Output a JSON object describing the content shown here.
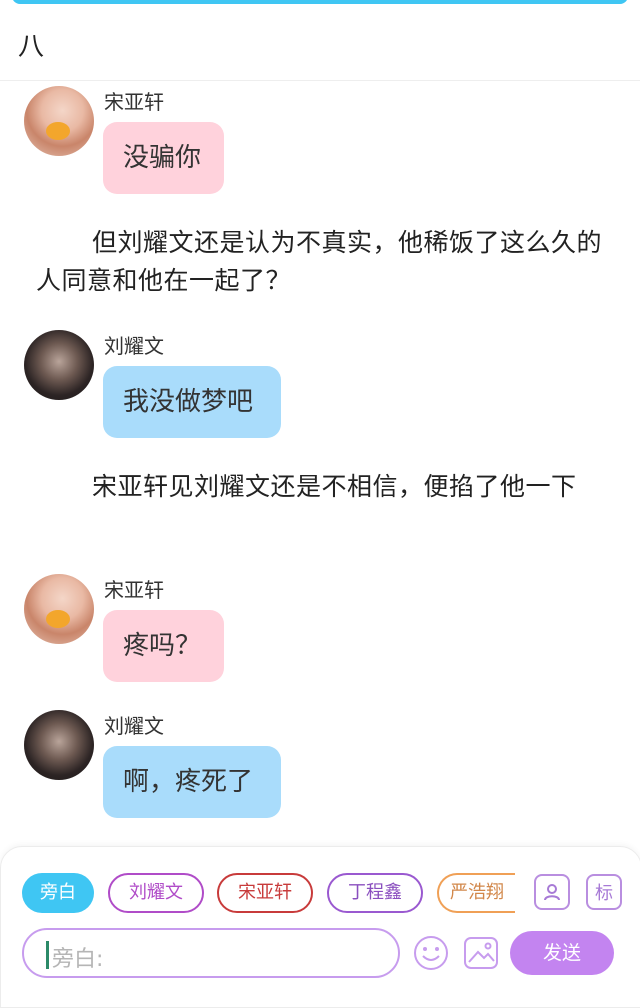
{
  "header": {
    "title": "八"
  },
  "messages": [
    {
      "speaker": "宋亚轩",
      "text": "没骗你"
    },
    {
      "narration": "但刘耀文还是认为不真实，他稀饭了这么久的人同意和他在一起了？"
    },
    {
      "speaker": "刘耀文",
      "text": "我没做梦吧"
    },
    {
      "narration": "宋亚轩见刘耀文还是不相信，便掐了他一下"
    },
    {
      "speaker": "宋亚轩",
      "text": "疼吗？"
    },
    {
      "speaker": "刘耀文",
      "text": "啊，疼死了"
    }
  ],
  "composer": {
    "roles": [
      "旁白",
      "刘耀文",
      "宋亚轩",
      "丁程鑫",
      "严浩翔"
    ],
    "active_role": "旁白",
    "mark_label": "标",
    "input_placeholder": "旁白:",
    "send_label": "发送"
  },
  "colors": {
    "accent": "#3fc6f3",
    "pink_bubble": "#ffd2dc",
    "blue_bubble": "#a9dcfb",
    "send": "#c384f0"
  }
}
